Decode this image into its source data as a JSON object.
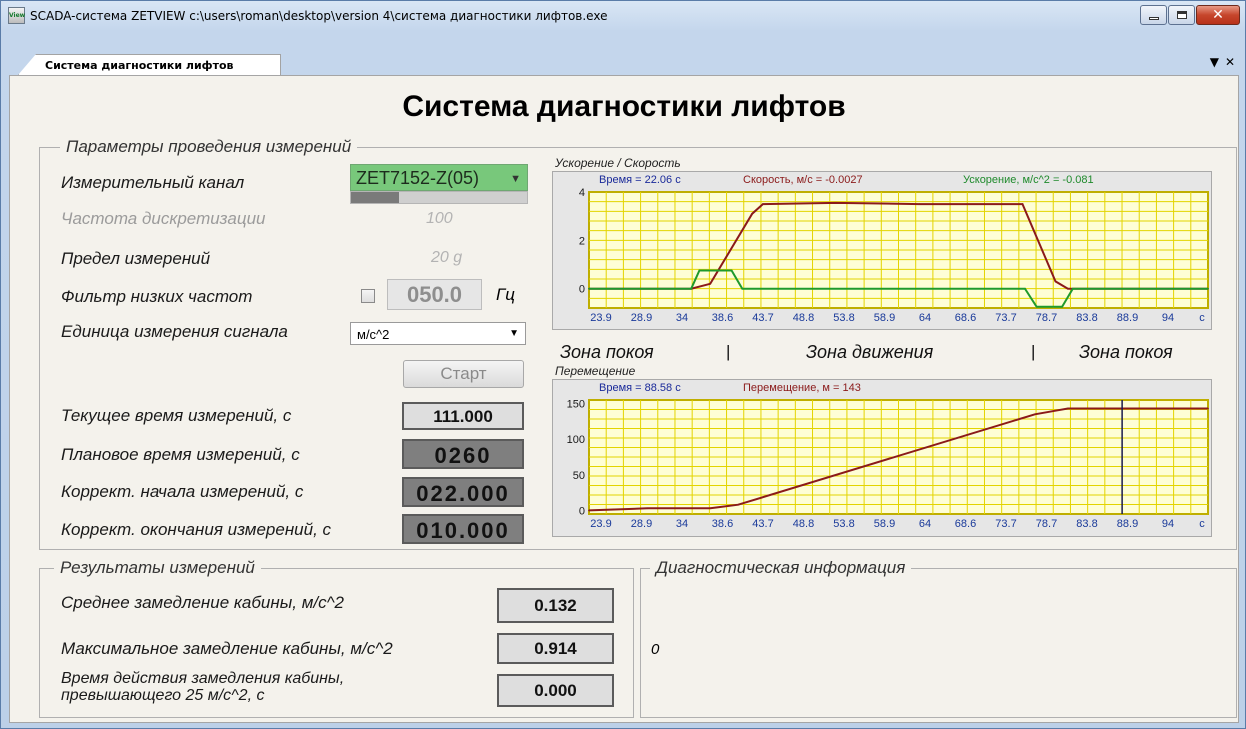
{
  "window": {
    "title": "SCADA-система ZETVIEW c:\\users\\roman\\desktop\\version 4\\система диагностики лифтов.exe",
    "icon_text": "View"
  },
  "tab": {
    "label": "Система диагностики лифтов"
  },
  "page": {
    "title": "Система диагностики лифтов"
  },
  "params": {
    "caption": "Параметры проведения измерений",
    "channel_label": "Измерительный канал",
    "channel_value": "ZET7152-Z(05)",
    "channel_signal_fraction": 0.27,
    "rate_label": "Частота дискретизации",
    "rate_value": "100",
    "range_label": "Предел измерений",
    "range_value": "20 g",
    "filter_label": "Фильтр низких частот",
    "filter_value": "050.0",
    "filter_unit": "Гц",
    "filter_checked": false,
    "unit_label": "Единица измерения сигнала",
    "unit_value": "м/с^2",
    "start_label": "Старт",
    "current_time_label": "Текущее время измерений, с",
    "current_time_value": "111.000",
    "planned_time_label": "Плановое время измерений, с",
    "planned_time_value": "0260",
    "start_corr_label": "Коррект. начала измерений, с",
    "start_corr_value": "022.000",
    "end_corr_label": "Коррект. окончания измерений, с",
    "end_corr_value": "010.000"
  },
  "results": {
    "caption": "Результаты измерений",
    "avg_label": "Среднее замедление кабины, м/с^2",
    "avg_value": "0.132",
    "max_label": "Максимальное замедление кабины, м/с^2",
    "max_value": "0.914",
    "time_label_1": "Время действия замедления кабины,",
    "time_label_2": "превышающего 25 м/с^2, с",
    "time_value": "0.000"
  },
  "diagnostics": {
    "caption": "Диагностическая информация",
    "value": "0"
  },
  "zones": {
    "rest_left": "Зона покоя",
    "motion": "Зона движения",
    "rest_right": "Зона покоя",
    "separator": "|"
  },
  "colors": {
    "plot_bg": "#fefed6",
    "grid": "#e3d400",
    "velocity": "#8b1a1a",
    "acceleration": "#1f9a2c",
    "cursor": "#1a1a4e"
  },
  "chart_data": [
    {
      "type": "line",
      "title": "Ускорение / Скорость",
      "readouts": {
        "time": "Время = 22.06 с",
        "velocity": "Скорость, м/с = -0.0027",
        "acceleration": "Ускорение, м/с^2 = -0.081"
      },
      "x_tick_labels": [
        "23.9",
        "28.9",
        "34",
        "38.6",
        "43.7",
        "48.8",
        "53.8",
        "58.9",
        "64",
        "68.6",
        "73.7",
        "78.7",
        "83.8",
        "88.9",
        "94",
        "с"
      ],
      "y_tick_labels": [
        "4",
        "2",
        "0"
      ],
      "xlim": [
        23.9,
        99
      ],
      "ylim": [
        -0.8,
        4
      ],
      "series": [
        {
          "name": "Скорость, м/с",
          "x": [
            23.9,
            36.3,
            38.6,
            43.7,
            45.0,
            53.8,
            64.0,
            76.5,
            80.5,
            82.0,
            99.0
          ],
          "y": [
            0,
            0,
            0.2,
            3.1,
            3.5,
            3.55,
            3.5,
            3.5,
            0.3,
            0,
            0
          ]
        },
        {
          "name": "Ускорение, м/с^2",
          "x": [
            23.9,
            30.0,
            36.3,
            37.3,
            41.2,
            42.5,
            76.8,
            78.2,
            81.3,
            82.6,
            99.0
          ],
          "y": [
            0,
            0,
            0,
            0.75,
            0.75,
            0,
            0,
            -0.75,
            -0.75,
            0,
            0
          ]
        }
      ]
    },
    {
      "type": "line",
      "title": "Перемещение",
      "readouts": {
        "time": "Время = 88.58 с",
        "displacement": "Перемещение, м = 143"
      },
      "x_tick_labels": [
        "23.9",
        "28.9",
        "34",
        "38.6",
        "43.7",
        "48.8",
        "53.8",
        "58.9",
        "64",
        "68.6",
        "73.7",
        "78.7",
        "83.8",
        "88.9",
        "94",
        "с"
      ],
      "y_tick_labels": [
        "150",
        "100",
        "50",
        "0"
      ],
      "xlim": [
        23.9,
        99
      ],
      "ylim": [
        -5,
        155
      ],
      "cursor_x": 88.58,
      "series": [
        {
          "name": "Перемещение, м",
          "x": [
            23.9,
            31.0,
            38.6,
            42.0,
            78.0,
            80.5,
            82.0,
            99.0
          ],
          "y": [
            0,
            3,
            3,
            8,
            135,
            140,
            143,
            143
          ]
        }
      ]
    }
  ]
}
